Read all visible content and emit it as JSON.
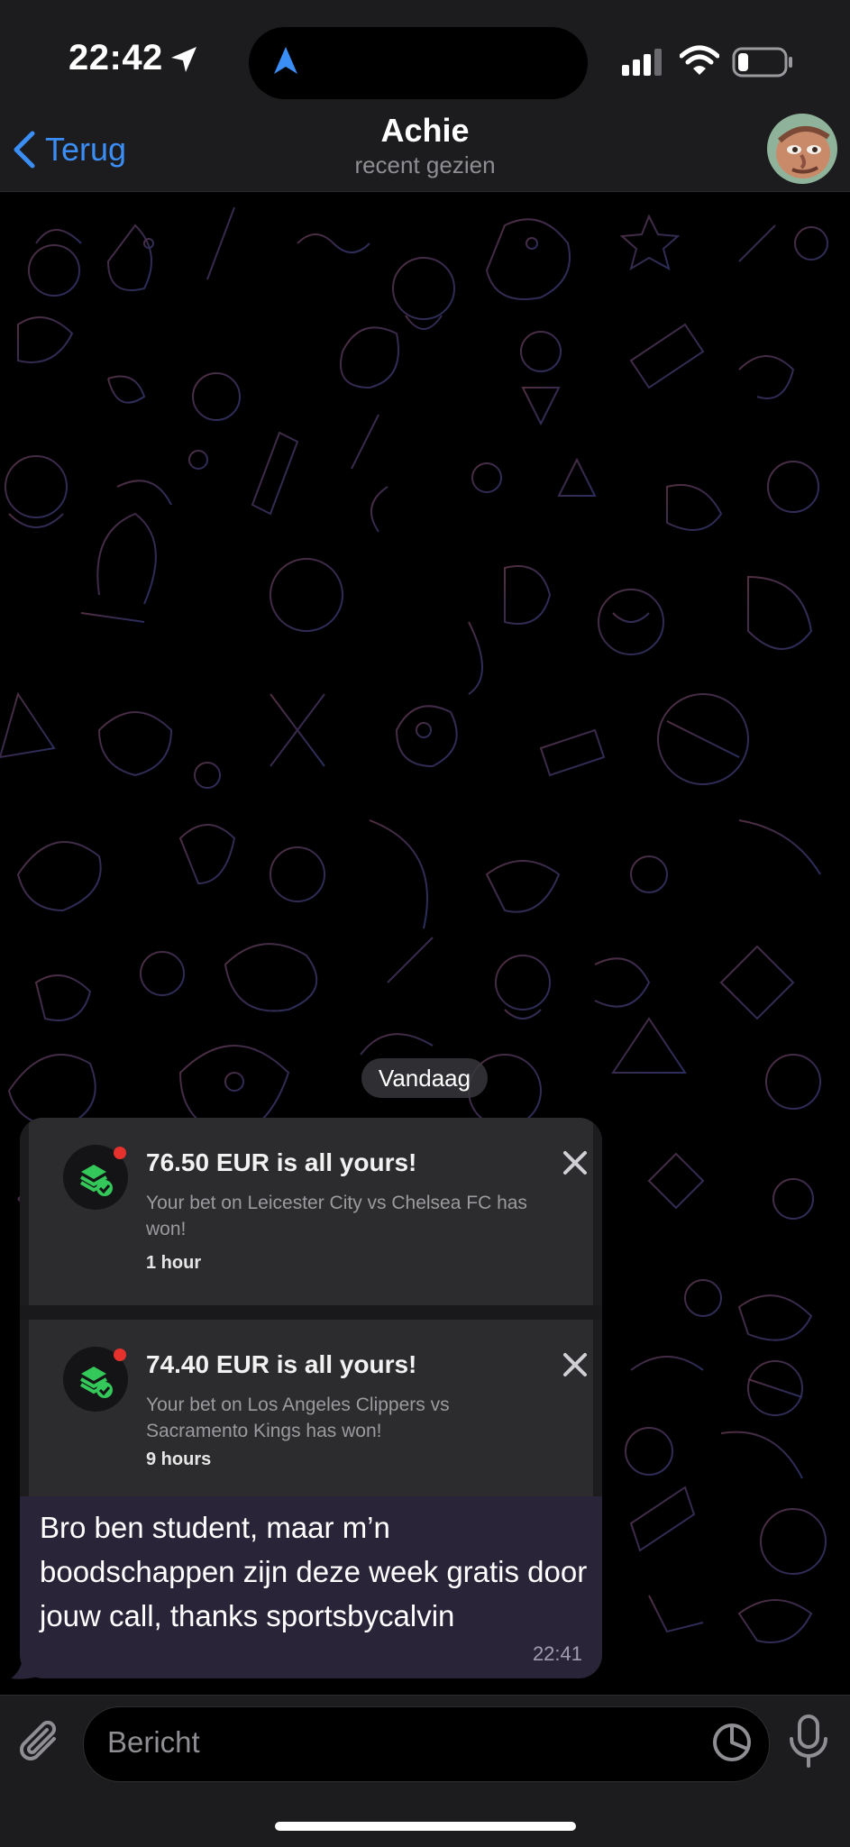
{
  "status_bar": {
    "time": "22:42"
  },
  "nav": {
    "back_label": "Terug",
    "title": "Achie",
    "subtitle": "recent gezien"
  },
  "chat": {
    "date_separator": "Vandaag",
    "message": {
      "screenshot": {
        "notifications": [
          {
            "title": "76.50 EUR is all yours!",
            "body": "Your bet on Leicester City vs Chelsea FC has won!",
            "time": "1 hour"
          },
          {
            "title": "74.40 EUR is all yours!",
            "body": "Your bet on Los Angeles Clippers vs Sacramento Kings has won!",
            "time": "9 hours"
          }
        ]
      },
      "text": "Bro ben student, maar m’n boodschappen zijn deze week gratis door jouw call, thanks sportsbycalvin",
      "time": "22:41"
    }
  },
  "input": {
    "placeholder": "Bericht"
  },
  "colors": {
    "accent": "#3b8ef5",
    "bubble": "#2a2438",
    "notification_dot": "#e5322d",
    "app_icon_green": "#34c759"
  },
  "icons": {
    "back": "chevron-left-icon",
    "attach": "paperclip-icon",
    "sticker": "sticker-icon",
    "mic": "microphone-icon",
    "close": "close-icon"
  }
}
